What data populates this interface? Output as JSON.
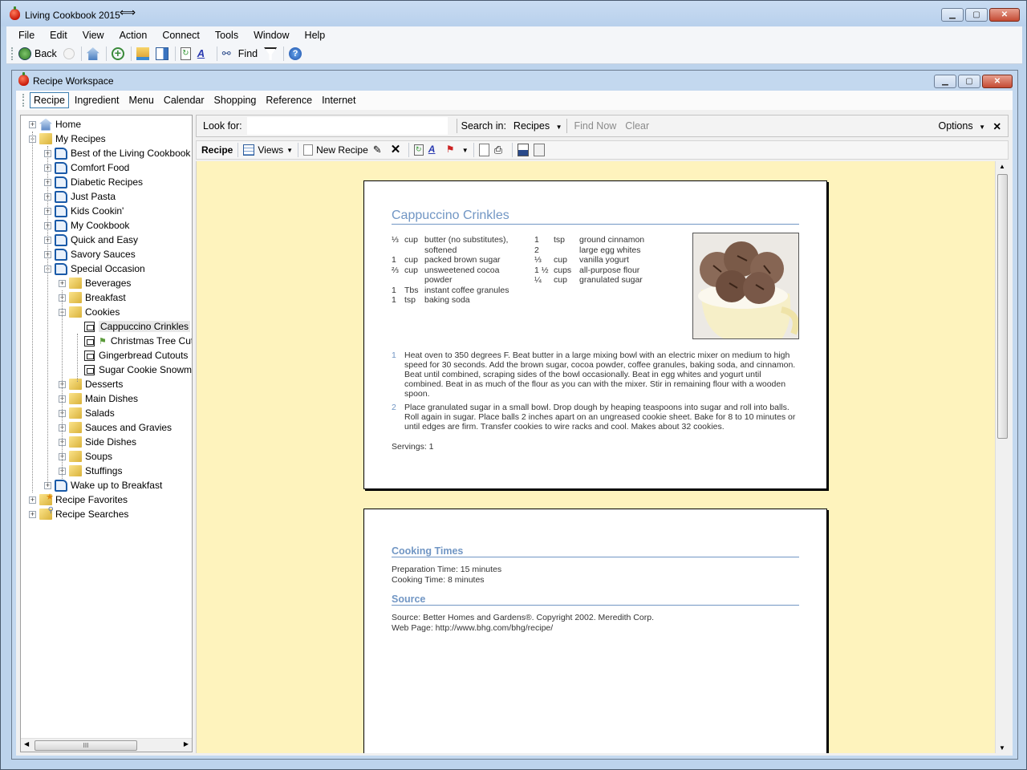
{
  "app": {
    "title": "Living Cookbook 2015",
    "window_controls": {
      "minimize": "–",
      "maximize": "▫",
      "close": "✕"
    }
  },
  "menu": [
    "File",
    "Edit",
    "View",
    "Action",
    "Connect",
    "Tools",
    "Window",
    "Help"
  ],
  "toolbar": {
    "back_label": "Back",
    "find_label": "Find",
    "icons": [
      "back-icon",
      "forward-icon",
      "home-icon",
      "add-icon",
      "open-folder-icon",
      "layout-icon",
      "refresh-icon",
      "font-icon",
      "binoculars-icon",
      "filter-icon",
      "help-icon"
    ]
  },
  "workspace": {
    "title": "Recipe Workspace",
    "nav_tabs": [
      {
        "label": "Recipe",
        "active": true
      },
      {
        "label": "Ingredient",
        "active": false
      },
      {
        "label": "Menu",
        "active": false
      },
      {
        "label": "Calendar",
        "active": false
      },
      {
        "label": "Shopping",
        "active": false
      },
      {
        "label": "Reference",
        "active": false
      },
      {
        "label": "Internet",
        "active": false
      }
    ]
  },
  "tree": {
    "items": [
      {
        "label": "Home",
        "level": 0,
        "icon": "home",
        "expander": "+"
      },
      {
        "label": "My Recipes",
        "level": 0,
        "icon": "folder",
        "expander": "-"
      },
      {
        "label": "Best of the Living Cookbook",
        "level": 1,
        "icon": "book",
        "expander": "+"
      },
      {
        "label": "Comfort Food",
        "level": 1,
        "icon": "book",
        "expander": "+"
      },
      {
        "label": "Diabetic Recipes",
        "level": 1,
        "icon": "book",
        "expander": "+"
      },
      {
        "label": "Just Pasta",
        "level": 1,
        "icon": "book",
        "expander": "+"
      },
      {
        "label": "Kids Cookin'",
        "level": 1,
        "icon": "book",
        "expander": "+"
      },
      {
        "label": "My Cookbook",
        "level": 1,
        "icon": "book",
        "expander": "+"
      },
      {
        "label": "Quick and Easy",
        "level": 1,
        "icon": "book",
        "expander": "+"
      },
      {
        "label": "Savory Sauces",
        "level": 1,
        "icon": "book",
        "expander": "+"
      },
      {
        "label": "Special Occasion",
        "level": 1,
        "icon": "book",
        "expander": "-"
      },
      {
        "label": "Beverages",
        "level": 2,
        "icon": "folder",
        "expander": "+"
      },
      {
        "label": "Breakfast",
        "level": 2,
        "icon": "folder",
        "expander": "+"
      },
      {
        "label": "Cookies",
        "level": 2,
        "icon": "folder",
        "expander": "-"
      },
      {
        "label": "Cappuccino Crinkles",
        "level": 3,
        "icon": "recipe",
        "expander": "",
        "selected": true
      },
      {
        "label": "Christmas Tree Cutouts",
        "level": 3,
        "icon": "recipe",
        "expander": "",
        "flag": true
      },
      {
        "label": "Gingerbread Cutouts",
        "level": 3,
        "icon": "recipe",
        "expander": ""
      },
      {
        "label": "Sugar Cookie Snowmen",
        "level": 3,
        "icon": "recipe",
        "expander": ""
      },
      {
        "label": "Desserts",
        "level": 2,
        "icon": "folder",
        "expander": "+"
      },
      {
        "label": "Main Dishes",
        "level": 2,
        "icon": "folder",
        "expander": "+"
      },
      {
        "label": "Salads",
        "level": 2,
        "icon": "folder",
        "expander": "+"
      },
      {
        "label": "Sauces and Gravies",
        "level": 2,
        "icon": "folder",
        "expander": "+"
      },
      {
        "label": "Side Dishes",
        "level": 2,
        "icon": "folder",
        "expander": "+"
      },
      {
        "label": "Soups",
        "level": 2,
        "icon": "folder",
        "expander": "+"
      },
      {
        "label": "Stuffings",
        "level": 2,
        "icon": "folder",
        "expander": "+"
      },
      {
        "label": "Wake up to Breakfast",
        "level": 1,
        "icon": "book",
        "expander": "+"
      },
      {
        "label": "Recipe Favorites",
        "level": 0,
        "icon": "favorites",
        "expander": "+"
      },
      {
        "label": "Recipe Searches",
        "level": 0,
        "icon": "searches",
        "expander": "+"
      }
    ]
  },
  "search": {
    "look_for_label": "Look for:",
    "look_for_value": "",
    "search_in_label": "Search in:",
    "search_in_value": "Recipes",
    "find_now": "Find Now",
    "clear": "Clear",
    "options": "Options"
  },
  "recipe_toolbar": {
    "title": "Recipe",
    "views": "Views",
    "new_recipe": "New Recipe"
  },
  "recipe": {
    "name": "Cappuccino Crinkles",
    "ingredients_col1": [
      {
        "qty": "⅓",
        "unit": "cup",
        "name": "butter (no substitutes), softened"
      },
      {
        "qty": "1",
        "unit": "cup",
        "name": "packed brown sugar"
      },
      {
        "qty": "⅔",
        "unit": "cup",
        "name": "unsweetened cocoa powder"
      },
      {
        "qty": "1",
        "unit": "Tbs",
        "name": "instant coffee granules"
      },
      {
        "qty": "1",
        "unit": "tsp",
        "name": "baking soda"
      }
    ],
    "ingredients_col2": [
      {
        "qty": "1",
        "unit": "tsp",
        "name": "ground cinnamon"
      },
      {
        "qty": "2",
        "unit": "",
        "name": "large egg whites"
      },
      {
        "qty": "⅓",
        "unit": "cup",
        "name": "vanilla yogurt"
      },
      {
        "qty": "1 ½",
        "unit": "cups",
        "name": "all-purpose flour"
      },
      {
        "qty": "¼",
        "unit": "cup",
        "name": "granulated sugar"
      }
    ],
    "steps": [
      {
        "num": "1",
        "text": "Heat oven to 350 degrees F. Beat butter in a large mixing bowl with an electric mixer on medium to high speed for 30 seconds. Add the brown sugar, cocoa powder, coffee granules, baking soda, and cinnamon. Beat until combined, scraping sides of the bowl occasionally. Beat in egg whites and yogurt until combined. Beat in as much of the flour as you can with the mixer. Stir in remaining flour with a wooden spoon."
      },
      {
        "num": "2",
        "text": "Place granulated sugar in a small bowl. Drop dough by heaping teaspoons into sugar and roll into balls. Roll again in sugar. Place balls 2 inches apart on an ungreased cookie sheet. Bake for 8 to 10 minutes or until edges are firm. Transfer cookies to wire racks and cool. Makes about 32 cookies."
      }
    ],
    "servings": "Servings: 1",
    "cooking_times_heading": "Cooking Times",
    "prep_time": "Preparation Time: 15 minutes",
    "cook_time": "Cooking Time: 8 minutes",
    "source_heading": "Source",
    "source": "Source: Better Homes and Gardens®. Copyright 2002. Meredith Corp.",
    "web_page": "Web Page: http://www.bhg.com/bhg/recipe/"
  },
  "colors": {
    "accent": "#7196c4",
    "viewer_bg": "#fef3bd",
    "chrome": "#bcd3ec"
  }
}
